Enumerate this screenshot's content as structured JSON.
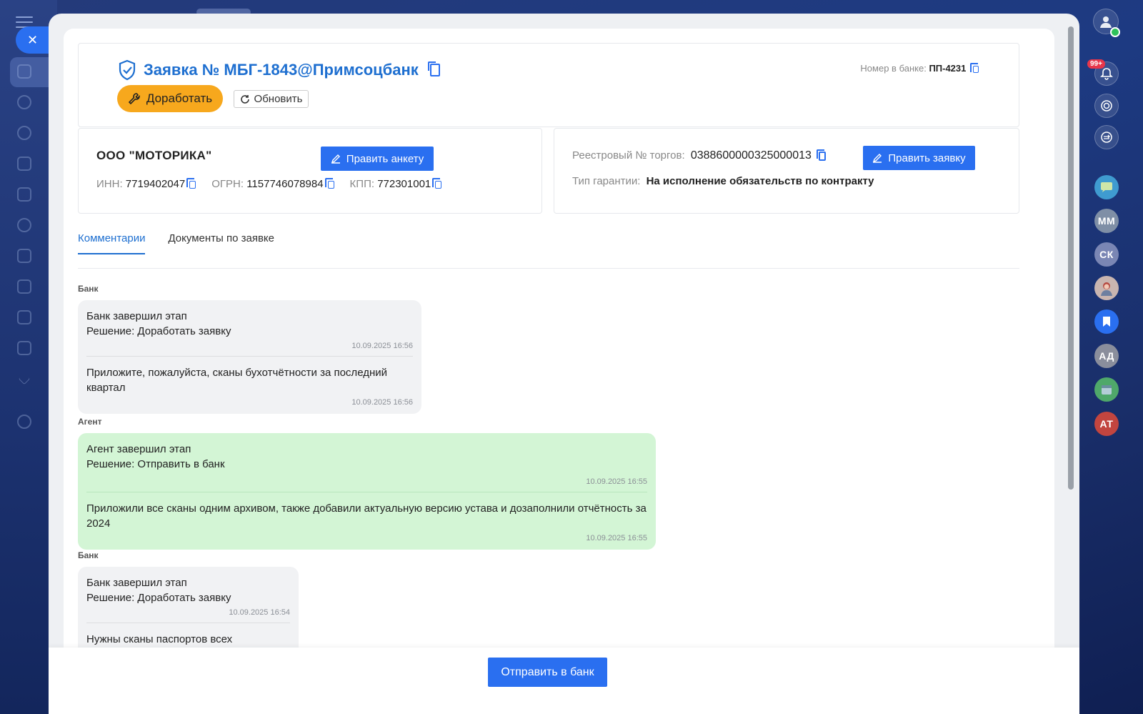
{
  "request": {
    "title": "Заявка № МБГ-1843@Примсоцбанк",
    "bank_number_label": "Номер в банке:",
    "bank_number": "ПП-4231",
    "rework_label": "Доработать",
    "refresh_label": "Обновить"
  },
  "company": {
    "name": "ООО \"МОТОРИКА\"",
    "edit_label": "Править анкету",
    "inn_label": "ИНН:",
    "inn": "7719402047",
    "ogrn_label": "ОГРН:",
    "ogrn": "1157746078984",
    "kpp_label": "КПП:",
    "kpp": "772301001"
  },
  "tender": {
    "registry_label": "Реестровый № торгов:",
    "registry_number": "0388600000325000013",
    "edit_label": "Править заявку",
    "guarantee_label": "Тип гарантии:",
    "guarantee_type": "На исполнение обязательств по контракту"
  },
  "tabs": [
    {
      "label": "Комментарии",
      "active": true
    },
    {
      "label": "Документы по заявке",
      "active": false
    }
  ],
  "comments": [
    {
      "sender": "Банк",
      "lines": [
        "Банк завершил этап",
        "Решение: Доработать заявку"
      ],
      "time1": "10.09.2025 16:56",
      "text": "Приложите, пожалуйста, сканы бухотчётности за последний квартал",
      "time2": "10.09.2025 16:56"
    },
    {
      "sender": "Агент",
      "lines": [
        "Агент завершил этап",
        "Решение: Отправить в банк"
      ],
      "time1": "10.09.2025 16:55",
      "text": "Приложили все сканы одним архивом, также добавили актуальную версию устава и дозаполнили отчётность за 2024",
      "time2": "10.09.2025 16:55"
    },
    {
      "sender": "Банк",
      "lines": [
        "Банк завершил этап",
        "Решение: Доработать заявку"
      ],
      "time1": "10.09.2025 16:54",
      "text": "Нужны сканы паспортов всех учредителей"
    }
  ],
  "footer": {
    "send_label": "Отправить в банк"
  },
  "rail": {
    "notifications_badge": "99+",
    "avatars": [
      {
        "initials": "ММ",
        "color": "#7f8fa6"
      },
      {
        "initials": "СК",
        "color": "#7a86b4"
      },
      {
        "initials": "АД",
        "color": "#8a8e9c"
      },
      {
        "initials": "АТ",
        "color": "#c2453f"
      }
    ]
  },
  "colors": {
    "accent": "#2a6ff0",
    "warning": "#f7a81d",
    "agent_bubble": "#d3f5d5",
    "bank_bubble": "#f1f2f4"
  }
}
